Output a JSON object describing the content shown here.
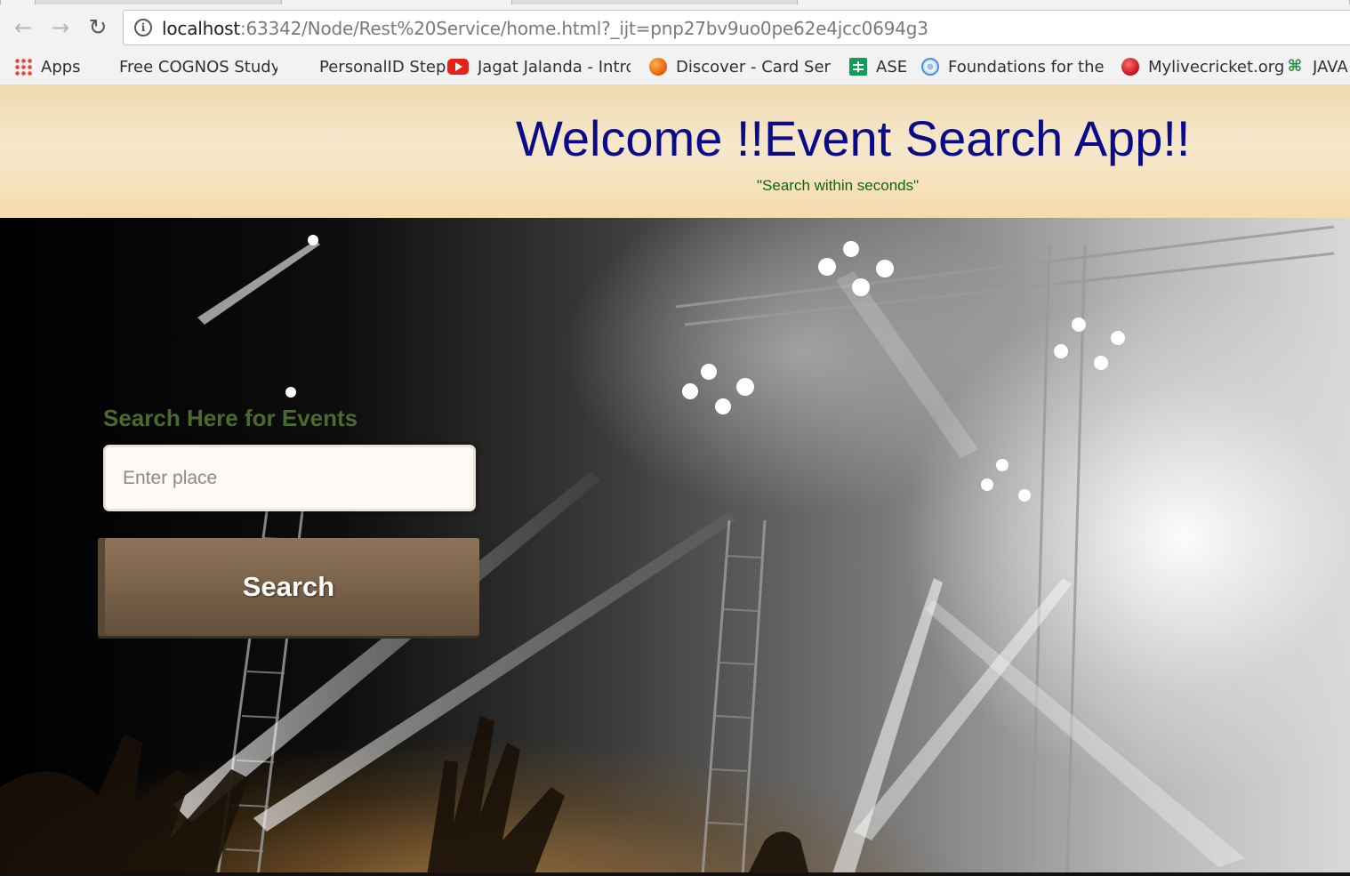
{
  "browser": {
    "url_host": "localhost",
    "url_rest": ":63342/Node/Rest%20Service/home.html?_ijt=pnp27bv9uo0pe62e4jcc0694g3",
    "bookmarks": [
      {
        "label": "Apps",
        "icon": "apps-grid-icon"
      },
      {
        "label": "Free COGNOS Study G",
        "icon": "page-icon"
      },
      {
        "label": "PersonalID Step",
        "icon": "page-icon"
      },
      {
        "label": "Jagat Jalanda - Intro -",
        "icon": "youtube-icon"
      },
      {
        "label": "Discover - Card Servic",
        "icon": "discover-icon"
      },
      {
        "label": "ASE",
        "icon": "sheets-icon"
      },
      {
        "label": "Foundations for the St",
        "icon": "globe-icon"
      },
      {
        "label": "Mylivecricket.org",
        "icon": "cricket-ball-icon"
      },
      {
        "label": "JAVA",
        "icon": "java-icon"
      }
    ]
  },
  "header": {
    "title": "Welcome !!Event Search App!!",
    "tagline": "\"Search within seconds\""
  },
  "search": {
    "label": "Search Here for Events",
    "placeholder": "Enter place",
    "value": "",
    "button_label": "Search"
  },
  "colors": {
    "title": "#0b0b8a",
    "tagline": "#0a6a0a",
    "search_label": "#4a6a2e",
    "button": "#7a624a",
    "header_band": "#f4dcae"
  }
}
